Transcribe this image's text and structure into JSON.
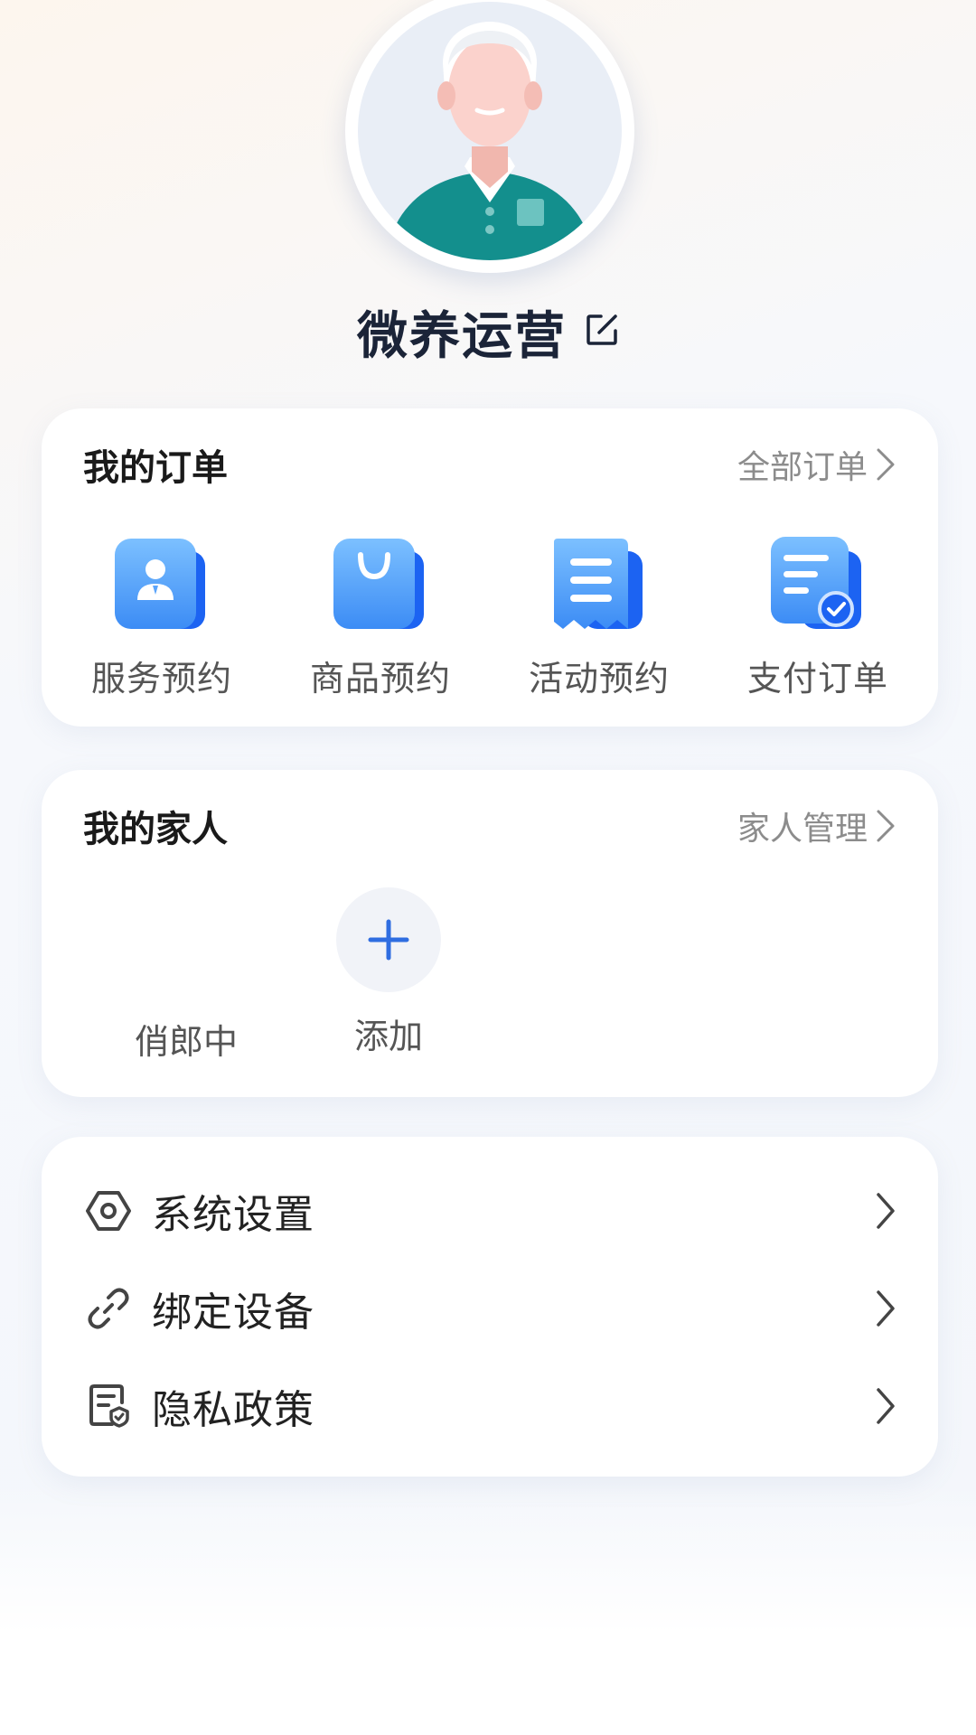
{
  "profile": {
    "name": "微养运营",
    "avatar_icon": "elderly-man-avatar-icon",
    "edit_icon": "edit-icon"
  },
  "orders": {
    "title": "我的订单",
    "link_label": "全部订单",
    "items": [
      {
        "label": "服务预约",
        "icon": "person-card-icon"
      },
      {
        "label": "商品预约",
        "icon": "shopping-bag-icon"
      },
      {
        "label": "活动预约",
        "icon": "receipt-icon"
      },
      {
        "label": "支付订单",
        "icon": "payment-check-icon"
      }
    ]
  },
  "family": {
    "title": "我的家人",
    "link_label": "家人管理",
    "members": [
      {
        "label": "俏郎中"
      }
    ],
    "add_label": "添加"
  },
  "menu": {
    "items": [
      {
        "label": "系统设置",
        "icon": "settings-hexagon-icon"
      },
      {
        "label": "绑定设备",
        "icon": "link-icon"
      },
      {
        "label": "隐私政策",
        "icon": "privacy-document-icon"
      }
    ]
  },
  "colors": {
    "accent_blue": "#2f6de1",
    "icon_blue_light": "#6fb3ff",
    "icon_blue_dark": "#1c63f2",
    "avatar_shirt": "#138f8d",
    "text_primary": "#1a1a1a",
    "text_secondary": "#8c8c8c"
  }
}
